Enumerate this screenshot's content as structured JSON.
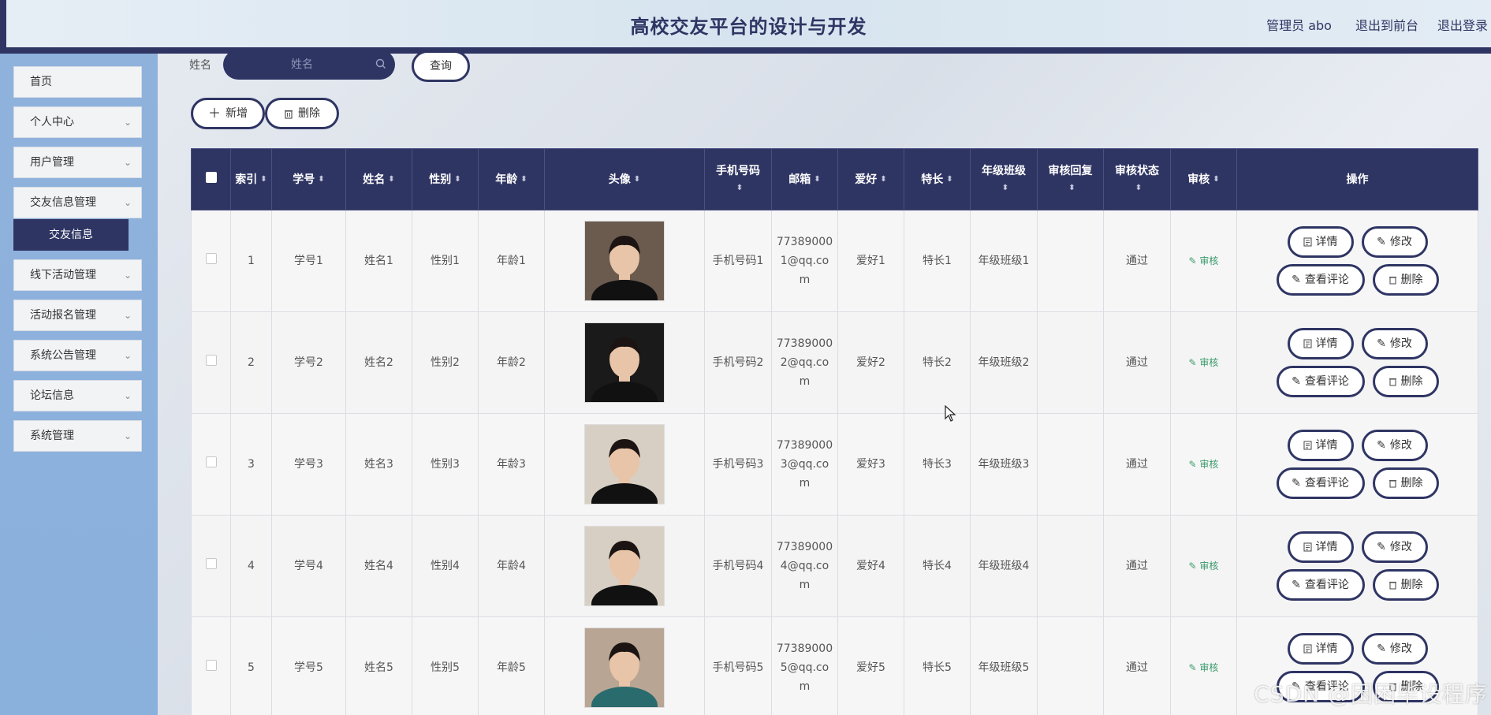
{
  "header": {
    "title": "高校交友平台的设计与开发",
    "admin_role": "管理员 abo",
    "front_link": "退出到前台",
    "logout_link": "退出登录"
  },
  "sidebar": {
    "items": [
      {
        "label": "首页",
        "has_chevron": false
      },
      {
        "label": "个人中心",
        "has_chevron": true
      },
      {
        "label": "用户管理",
        "has_chevron": true
      },
      {
        "label": "交友信息管理",
        "has_chevron": true
      },
      {
        "label": "线下活动管理",
        "has_chevron": true
      },
      {
        "label": "活动报名管理",
        "has_chevron": true
      },
      {
        "label": "系统公告管理",
        "has_chevron": true
      },
      {
        "label": "论坛信息",
        "has_chevron": true
      },
      {
        "label": "系统管理",
        "has_chevron": true
      }
    ],
    "active_sub": "交友信息"
  },
  "search": {
    "label": "姓名",
    "placeholder": "姓名",
    "query_button": "查询"
  },
  "toolbar": {
    "add_label": "新增",
    "delete_label": "删除"
  },
  "table": {
    "columns": [
      "索引",
      "学号",
      "姓名",
      "性别",
      "年龄",
      "头像",
      "手机号码",
      "邮箱",
      "爱好",
      "特长",
      "年级班级",
      "审核回复",
      "审核状态",
      "审核",
      "操作"
    ],
    "rows": [
      {
        "index": "1",
        "sid": "学号1",
        "name": "姓名1",
        "gender": "性别1",
        "age": "年龄1",
        "phone": "手机号码1",
        "email": "773890001@qq.com",
        "hobby": "爱好1",
        "talent": "特长1",
        "grade": "年级班级1",
        "reply": "",
        "status": "通过",
        "audit": "审核"
      },
      {
        "index": "2",
        "sid": "学号2",
        "name": "姓名2",
        "gender": "性别2",
        "age": "年龄2",
        "phone": "手机号码2",
        "email": "773890002@qq.com",
        "hobby": "爱好2",
        "talent": "特长2",
        "grade": "年级班级2",
        "reply": "",
        "status": "通过",
        "audit": "审核"
      },
      {
        "index": "3",
        "sid": "学号3",
        "name": "姓名3",
        "gender": "性别3",
        "age": "年龄3",
        "phone": "手机号码3",
        "email": "773890003@qq.com",
        "hobby": "爱好3",
        "talent": "特长3",
        "grade": "年级班级3",
        "reply": "",
        "status": "通过",
        "audit": "审核"
      },
      {
        "index": "4",
        "sid": "学号4",
        "name": "姓名4",
        "gender": "性别4",
        "age": "年龄4",
        "phone": "手机号码4",
        "email": "773890004@qq.com",
        "hobby": "爱好4",
        "talent": "特长4",
        "grade": "年级班级4",
        "reply": "",
        "status": "通过",
        "audit": "审核"
      },
      {
        "index": "5",
        "sid": "学号5",
        "name": "姓名5",
        "gender": "性别5",
        "age": "年龄5",
        "phone": "手机号码5",
        "email": "773890005@qq.com",
        "hobby": "爱好5",
        "talent": "特长5",
        "grade": "年级班级5",
        "reply": "",
        "status": "通过",
        "audit": "审核"
      }
    ],
    "ops": {
      "detail": "详情",
      "edit": "修改",
      "comments": "查看评论",
      "delete": "删除"
    }
  },
  "watermark": "CSDN @困困毕设程序",
  "colors": {
    "primary": "#2f3563",
    "sidebar": "#8fb2dc",
    "audit_green": "#3a9b6a"
  }
}
